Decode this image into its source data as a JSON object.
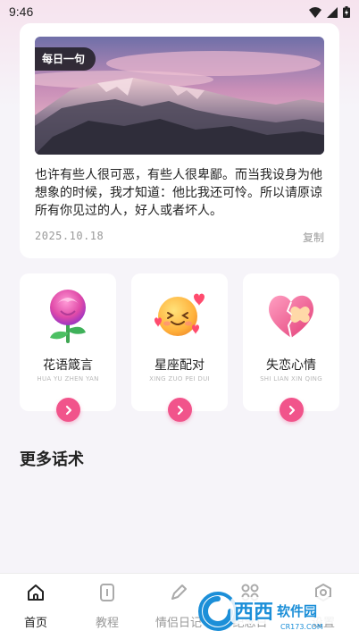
{
  "status_bar": {
    "time": "9:46"
  },
  "quote_card": {
    "badge": "每日一句",
    "text": "也许有些人很可恶，有些人很卑鄙。而当我设身为他想象的时候，我才知道：他比我还可怜。所以请原谅所有你见过的人，好人或者坏人。",
    "date": "2025.10.18",
    "copy_label": "复制"
  },
  "categories": [
    {
      "title": "花语箴言",
      "subtitle": "HUA YU ZHEN YAN",
      "icon": "rose-icon"
    },
    {
      "title": "星座配对",
      "subtitle": "XING ZUO PEI DUI",
      "icon": "smiling-face-hearts-icon"
    },
    {
      "title": "失恋心情",
      "subtitle": "SHI LIAN XIN QING",
      "icon": "broken-heart-icon"
    }
  ],
  "section": {
    "title": "更多话术"
  },
  "bottom_nav": [
    {
      "label": "首页",
      "icon": "home-icon",
      "active": true
    },
    {
      "label": "教程",
      "icon": "notebook-icon",
      "active": false
    },
    {
      "label": "情侣日记",
      "icon": "pen-icon",
      "active": false
    },
    {
      "label": "纪念日",
      "icon": "grid-icon",
      "active": false
    },
    {
      "label": "设置",
      "icon": "gear-icon",
      "active": false
    }
  ],
  "watermark": {
    "text": "西西软件园",
    "domain": "CR173.COM"
  },
  "colors": {
    "accent": "#f1548b",
    "background": "#f6f4f9",
    "card": "#ffffff"
  }
}
